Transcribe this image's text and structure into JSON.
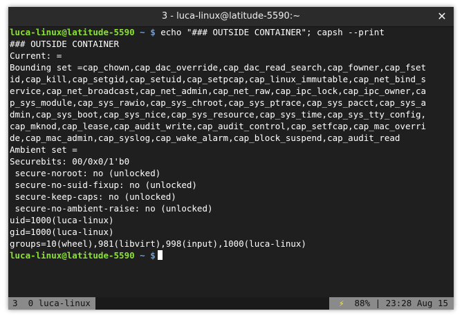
{
  "window": {
    "title": "3 - luca-linux@latitude-5590:~",
    "close_glyph": "✕"
  },
  "colors": {
    "prompt_user": "#8ae234",
    "prompt_path": "#729fcf",
    "background": "#1f1f1f",
    "status_bar": "#8a8a8a"
  },
  "terminal": {
    "prompt": {
      "userhost": "luca-linux@latitude-5590",
      "path": " ~ $"
    },
    "command": " echo \"### OUTSIDE CONTAINER\"; capsh --print",
    "output": [
      "### OUTSIDE CONTAINER",
      "Current: =",
      "Bounding set =cap_chown,cap_dac_override,cap_dac_read_search,cap_fowner,cap_fset",
      "id,cap_kill,cap_setgid,cap_setuid,cap_setpcap,cap_linux_immutable,cap_net_bind_s",
      "ervice,cap_net_broadcast,cap_net_admin,cap_net_raw,cap_ipc_lock,cap_ipc_owner,ca",
      "p_sys_module,cap_sys_rawio,cap_sys_chroot,cap_sys_ptrace,cap_sys_pacct,cap_sys_a",
      "dmin,cap_sys_boot,cap_sys_nice,cap_sys_resource,cap_sys_time,cap_sys_tty_config,",
      "cap_mknod,cap_lease,cap_audit_write,cap_audit_control,cap_setfcap,cap_mac_overri",
      "de,cap_mac_admin,cap_syslog,cap_wake_alarm,cap_block_suspend,cap_audit_read",
      "Ambient set =",
      "Securebits: 00/0x0/1'b0",
      " secure-noroot: no (unlocked)",
      " secure-no-suid-fixup: no (unlocked)",
      " secure-keep-caps: no (unlocked)",
      " secure-no-ambient-raise: no (unlocked)",
      "uid=1000(luca-linux)",
      "gid=1000(luca-linux)",
      "groups=10(wheel),981(libvirt),998(input),1000(luca-linux)"
    ]
  },
  "statusbar": {
    "left": "3  0 luca-linux",
    "battery_icon": "⚡",
    "battery": "  88%",
    "clock": " | 23:28 Aug 15"
  }
}
